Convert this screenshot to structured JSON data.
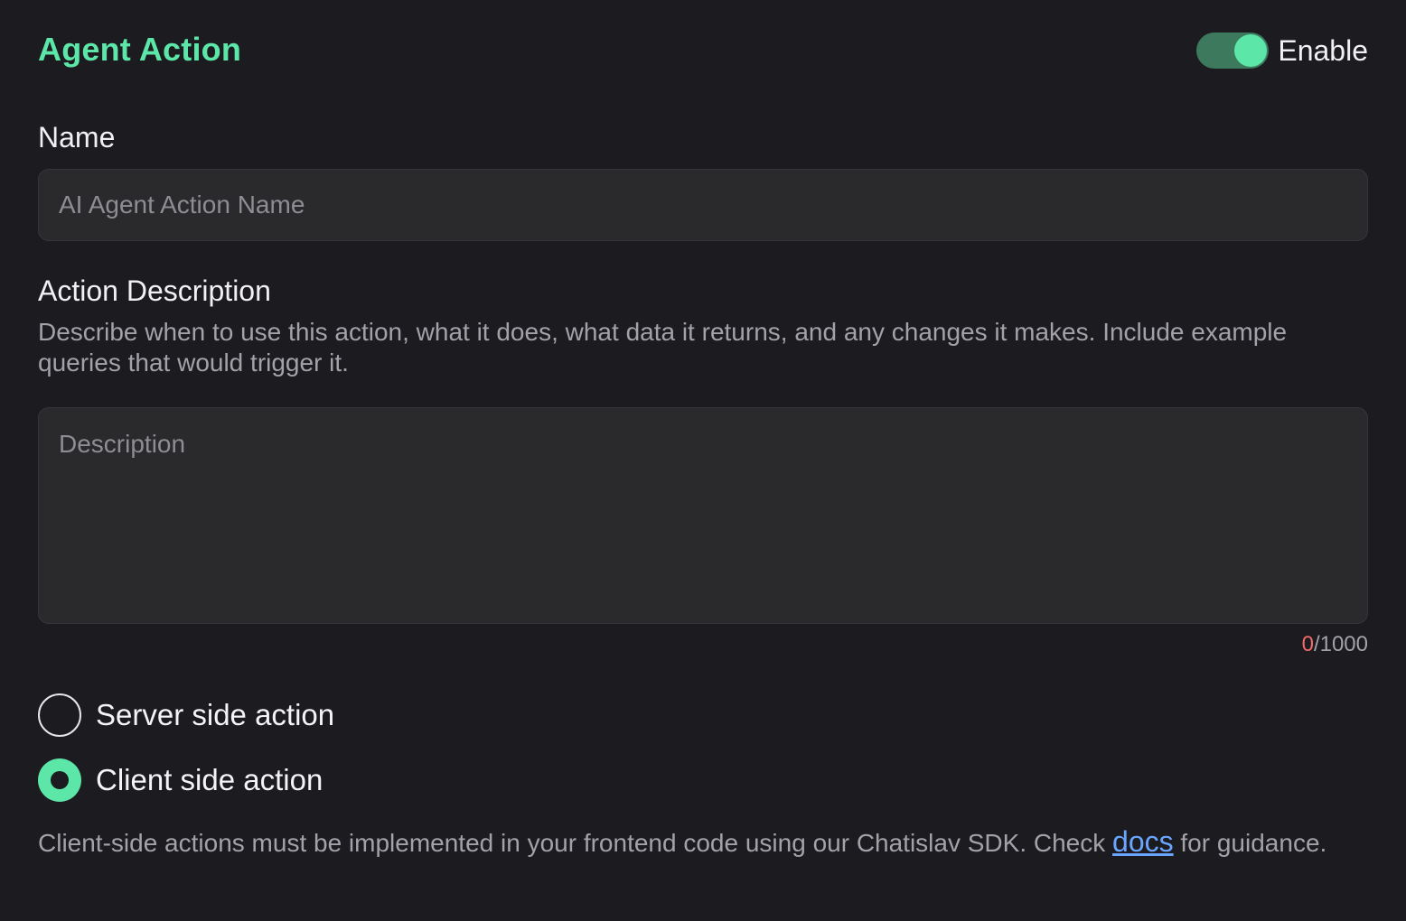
{
  "header": {
    "title": "Agent Action",
    "enable_label": "Enable",
    "enabled": true
  },
  "name": {
    "label": "Name",
    "placeholder": "AI Agent Action Name",
    "value": ""
  },
  "description": {
    "label": "Action Description",
    "help": "Describe when to use this action, what it does, what data it returns, and any changes it makes. Include example queries that would trigger it.",
    "placeholder": "Description",
    "value": "",
    "count": "0",
    "limit": "/1000"
  },
  "action_type": {
    "options": [
      {
        "label": "Server side action",
        "selected": false
      },
      {
        "label": "Client side action",
        "selected": true
      }
    ],
    "client_help_before": "Client-side actions must be implemented in your frontend code using our Chatislav SDK. Check ",
    "docs_link": "docs",
    "client_help_after": " for guidance."
  },
  "colors": {
    "accent": "#5ce6a8",
    "background": "#1c1b1f",
    "input_bg": "#2a2a2d",
    "link": "#6aa5ff",
    "counter_current": "#f16b6b"
  }
}
